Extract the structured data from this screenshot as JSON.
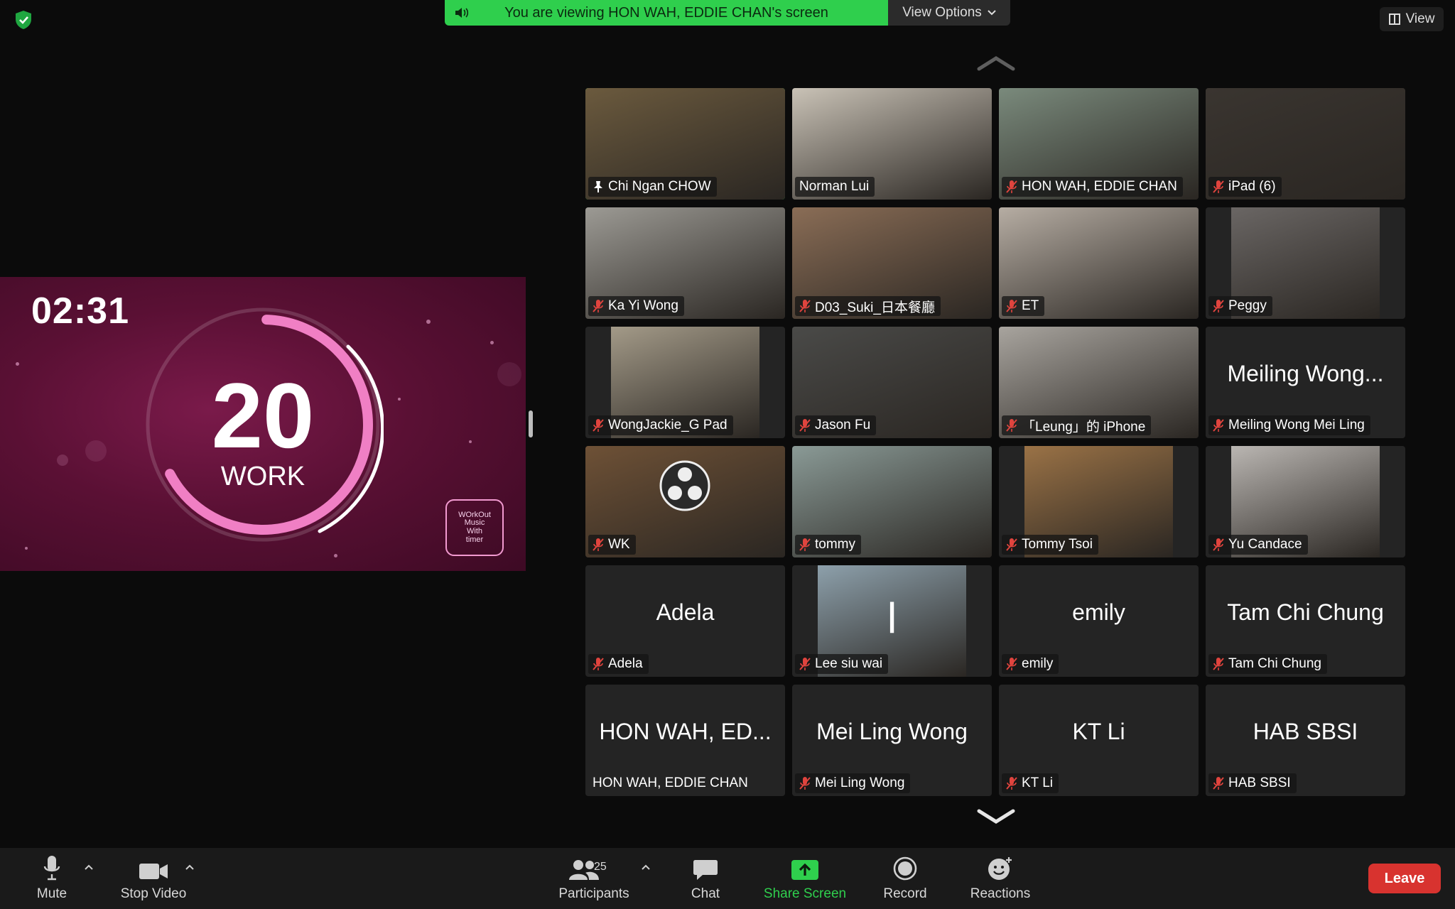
{
  "banner": {
    "message": "You are viewing HON WAH, EDDIE CHAN's screen",
    "view_options_label": "View Options"
  },
  "view_button": {
    "label": "View"
  },
  "shared_screen": {
    "timer": "02:31",
    "interval_number": "20",
    "interval_label": "WORK",
    "logo_lines": [
      "WOrkOut",
      "Music",
      "With",
      "timer"
    ]
  },
  "participants_tiles": [
    {
      "name": "Chi Ngan CHOW",
      "pinned": true,
      "muted": false,
      "active": true,
      "video_bg": "#6b5a3e"
    },
    {
      "name": "Norman Lui",
      "muted": false,
      "video_bg": "#c9c2b6"
    },
    {
      "name": "HON WAH, EDDIE CHAN",
      "muted": true,
      "video_bg": "#7a8a7c"
    },
    {
      "name": "iPad (6)",
      "muted": true,
      "video_bg": "#3a3530"
    },
    {
      "name": "Ka Yi Wong",
      "muted": true,
      "video_bg": "#9c9a94"
    },
    {
      "name": "D03_Suki_日本餐廳",
      "muted": true,
      "video_bg": "#8a6d56"
    },
    {
      "name": "ET",
      "muted": true,
      "video_bg": "#b6ada3"
    },
    {
      "name": "Peggy",
      "muted": true,
      "video_bg": "#6a6664",
      "video_inset": true
    },
    {
      "name": "WongJackie_G Pad",
      "muted": true,
      "video_bg": "#a39a88",
      "video_inset": true
    },
    {
      "name": "Jason Fu",
      "muted": true,
      "video_bg": "#4a4a48"
    },
    {
      "name": "「Leung」的 iPhone",
      "muted": true,
      "video_bg": "#a8a49e"
    },
    {
      "name": "Meiling Wong Mei Ling",
      "muted": true,
      "display_name": "Meiling Wong..."
    },
    {
      "name": "WK",
      "muted": true,
      "video_bg": "#6e5136",
      "obs": true
    },
    {
      "name": "tommy",
      "muted": true,
      "video_bg": "#8a9a96"
    },
    {
      "name": "Tommy Tsoi",
      "muted": true,
      "video_bg": "#9a7246",
      "video_inset": true
    },
    {
      "name": "Yu Candace",
      "muted": true,
      "video_bg": "#bab6b2",
      "video_inset": true
    },
    {
      "name": "Adela",
      "muted": true,
      "display_name": "Adela"
    },
    {
      "name": "Lee siu wai",
      "muted": true,
      "video_bg": "#8da0ab",
      "video_inset": true,
      "letter": "l"
    },
    {
      "name": "emily",
      "muted": true,
      "display_name": "emily"
    },
    {
      "name": "Tam Chi Chung",
      "muted": true,
      "display_name": "Tam Chi Chung"
    },
    {
      "name": "HON WAH, EDDIE CHAN",
      "muted": false,
      "display_name": "HON WAH, ED..."
    },
    {
      "name": "Mei Ling Wong",
      "muted": true,
      "display_name": "Mei Ling Wong"
    },
    {
      "name": "KT Li",
      "muted": true,
      "display_name": "KT Li"
    },
    {
      "name": "HAB SBSI",
      "muted": true,
      "display_name": "HAB SBSI"
    }
  ],
  "toolbar": {
    "mute_label": "Mute",
    "stop_video_label": "Stop Video",
    "participants_label": "Participants",
    "participants_count": "25",
    "chat_label": "Chat",
    "share_screen_label": "Share Screen",
    "record_label": "Record",
    "reactions_label": "Reactions",
    "leave_label": "Leave"
  },
  "colors": {
    "accent_green": "#2fcf4d",
    "leave_red": "#d8332f",
    "mic_off_red": "#e0443e",
    "ring_pink": "#f07fc4"
  }
}
